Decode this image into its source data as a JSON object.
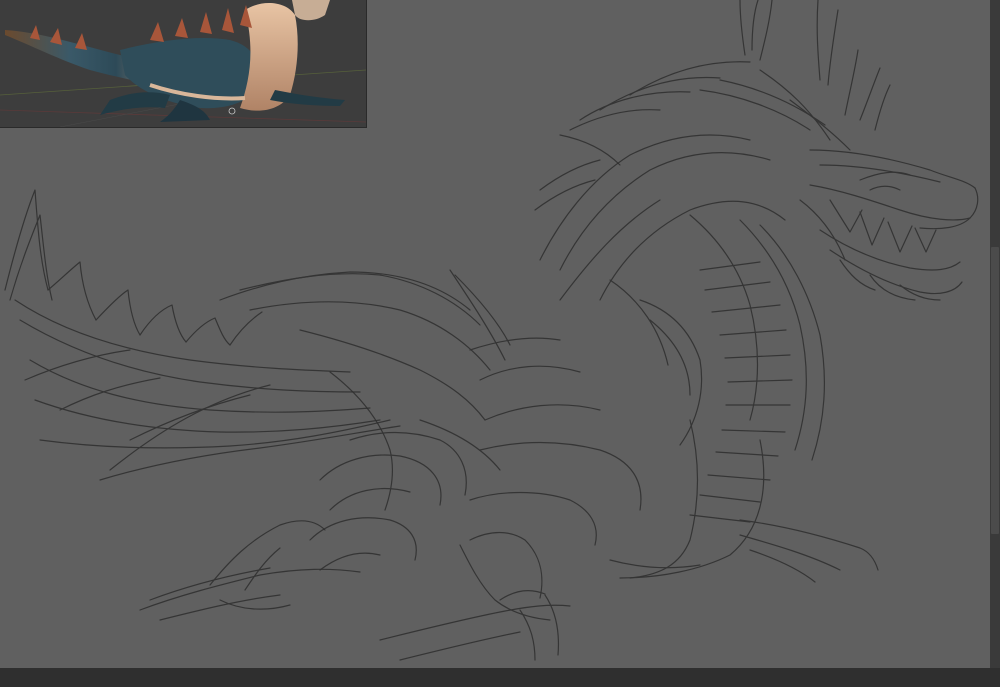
{
  "canvas": {
    "background": "#606060",
    "stroke_color": "#2e2e2e"
  },
  "reference_image": {
    "subject": "dragon-3d-render",
    "background": "#3d3d3d"
  },
  "scrollbar": {
    "thumb_start_fraction": 0.37,
    "thumb_end_fraction": 0.8
  },
  "statusbar": {
    "background": "#2f2f2f"
  }
}
